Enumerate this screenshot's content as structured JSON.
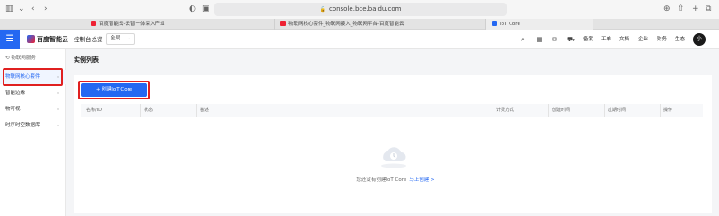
{
  "browser": {
    "url": "console.bce.baidu.com",
    "tabs": [
      {
        "title": "百度智能云-云智一体深入产业"
      },
      {
        "title": "物联网核心套件_物联网接入_物联网平台-百度智能云"
      },
      {
        "title": "IoT Core"
      }
    ]
  },
  "header": {
    "logo": "百度智能云",
    "home": "控制台总览",
    "region": "全局",
    "links": [
      "备案",
      "工单",
      "文档",
      "企业",
      "财务",
      "生态"
    ],
    "avatar": "小"
  },
  "sidebar": {
    "title": "物联网服务",
    "items": [
      {
        "label": "物联网核心套件"
      },
      {
        "label": "智能边缘"
      },
      {
        "label": "物可视"
      },
      {
        "label": "时序时空数据库"
      }
    ]
  },
  "main": {
    "title": "实例列表",
    "create_button": "+ 创建IoT Core",
    "columns": [
      "名称/ID",
      "状态",
      "描述",
      "计费方式",
      "创建时间",
      "过期时间",
      "操作"
    ],
    "empty_text": "您还没有创建IoT Core",
    "empty_link": "马上创建 >"
  }
}
